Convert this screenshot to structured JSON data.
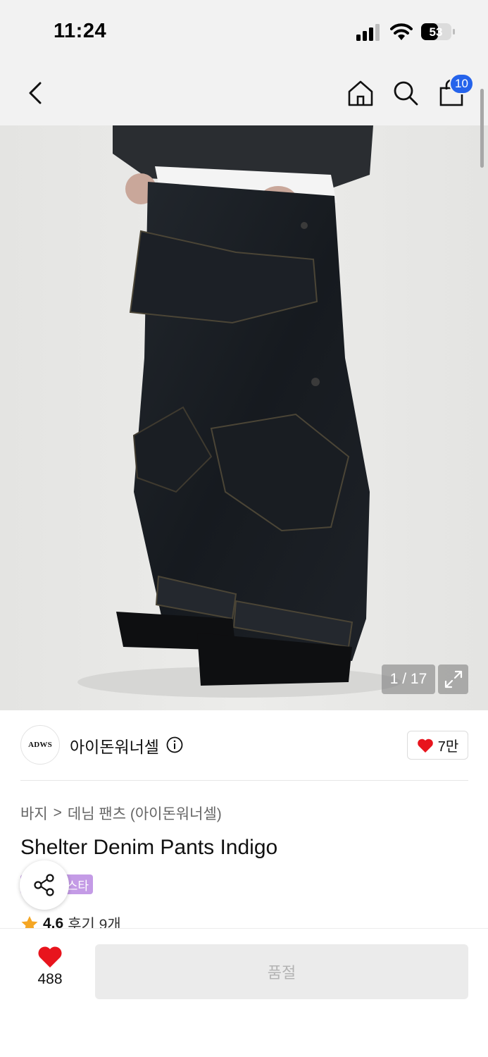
{
  "status_bar": {
    "time": "11:24",
    "battery": "53"
  },
  "nav": {
    "cart_badge": "10"
  },
  "gallery": {
    "counter": "1 / 17",
    "current": 1,
    "total": 17
  },
  "brand": {
    "logo_text": "ADWS",
    "name": "아이돈워너셀",
    "likes": "7만"
  },
  "breadcrumb": {
    "category": "바지",
    "separator": ">",
    "subcategory": "데님 팬츠 (아이돈워너셀)"
  },
  "product": {
    "title": "Shelter Denim Pants Indigo",
    "tag": "스타",
    "rating": "4.6",
    "reviews": "후기 9개"
  },
  "bottom": {
    "wish_count": "488",
    "soldout_label": "품절"
  },
  "colors": {
    "accent_blue": "#2563eb",
    "heart_red": "#e8141d",
    "star_orange": "#f5a623",
    "tag_purple": "#c49be6",
    "denim": "#1b1f24"
  },
  "icons": [
    "back-icon",
    "home-icon",
    "search-icon",
    "bag-icon",
    "expand-icon",
    "info-icon",
    "heart-icon",
    "share-icon",
    "star-icon"
  ]
}
